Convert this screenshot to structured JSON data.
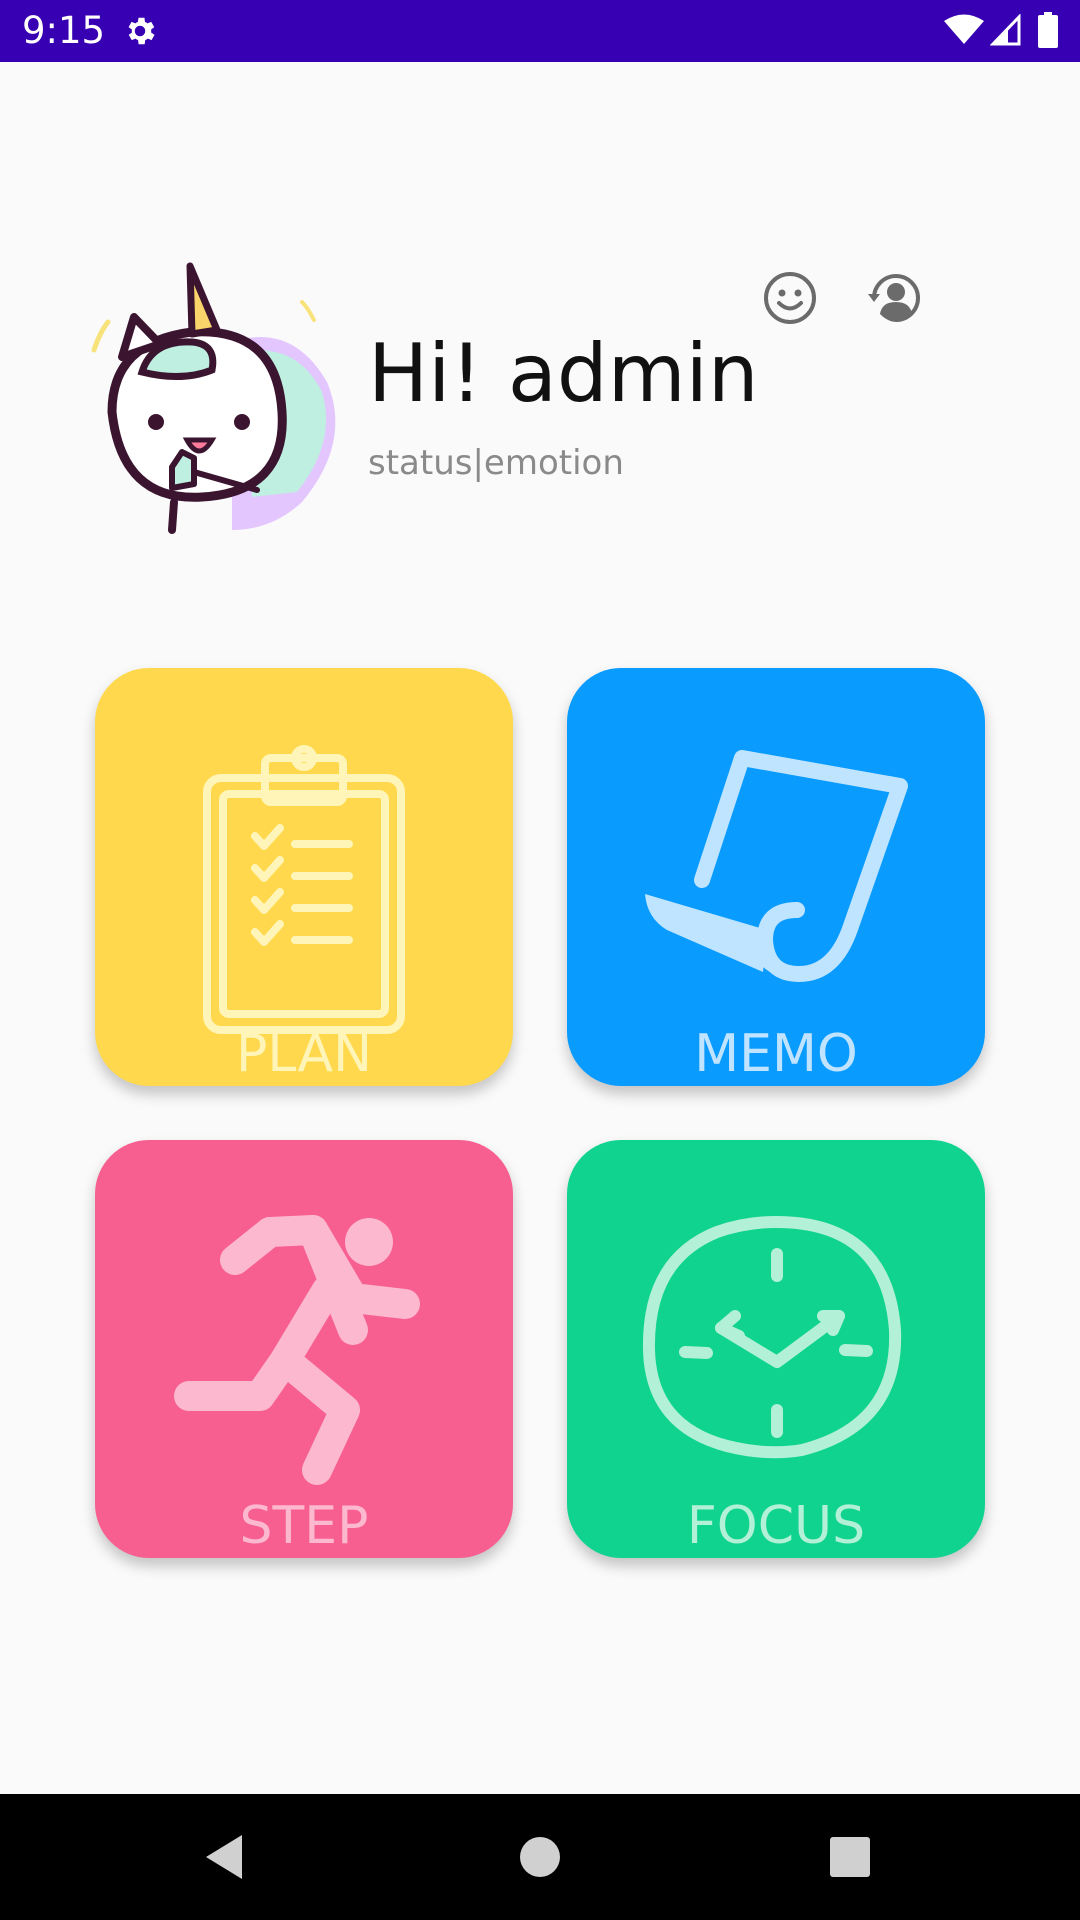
{
  "status_bar": {
    "time": "9:15",
    "icons": [
      "gear-icon",
      "wifi-icon",
      "signal-icon",
      "battery-icon"
    ]
  },
  "header": {
    "greeting": "Hi! admin",
    "subtitle": "status|emotion",
    "avatar": "unicorn-avatar",
    "actions": [
      "smiley-face-icon",
      "account-switch-icon"
    ]
  },
  "tiles": [
    {
      "label": "PLAN",
      "icon": "clipboard-checklist-icon",
      "color": "#ffd84d"
    },
    {
      "label": "MEMO",
      "icon": "paper-note-icon",
      "color": "#0a9bff"
    },
    {
      "label": "STEP",
      "icon": "running-person-icon",
      "color": "#f75f91"
    },
    {
      "label": "FOCUS",
      "icon": "clock-icon",
      "color": "#10d38f"
    }
  ],
  "navigation": [
    "back-icon",
    "home-icon",
    "recent-apps-icon"
  ],
  "colors": {
    "status_bar": "#3700b3",
    "background": "#fafafa",
    "nav_bar": "#000000"
  }
}
